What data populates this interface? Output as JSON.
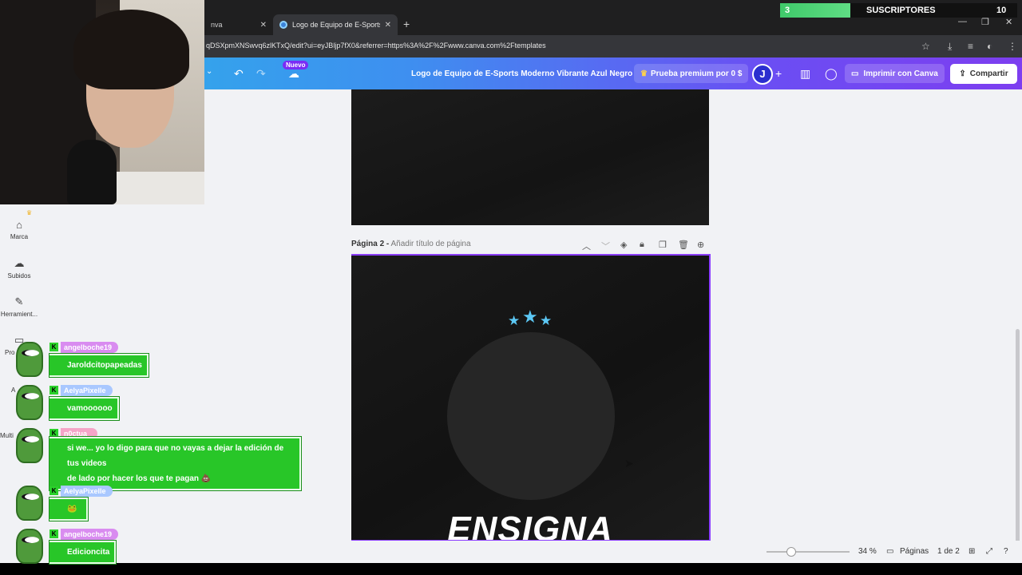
{
  "browser": {
    "tabs": [
      {
        "label": "nva",
        "active": false
      },
      {
        "label": "Logo de Equipo de E-Sports M",
        "active": true
      }
    ],
    "new_tab_icon": "+",
    "url": "qDSXpmXNSwvq6zlKTxQ/edit?ui=eyJBljp7fX0&referrer=https%3A%2F%2Fwww.canva.com%2Ftemplates"
  },
  "overlay_sub": {
    "current": "3",
    "label": "SUSCRIPTORES",
    "goal": "10",
    "progress": 0.3,
    "color": "#3fc96a"
  },
  "canva": {
    "nuevo_badge": "Nuevo",
    "document_title": "Logo de Equipo de E-Sports Moderno Vibrante Azul Negro",
    "premium_label": "Prueba premium por 0 $",
    "avatar_letter": "J",
    "print_label": "Imprimir con Canva",
    "share_label": "Compartir",
    "accent": "#8b3dff"
  },
  "page2": {
    "label": "Página 2 -",
    "title_placeholder": "Añadir título de página",
    "brand_text": "ENSIGNA",
    "star_color": "#5cc8f5"
  },
  "sidebar": {
    "items": [
      {
        "label": "Marca",
        "icon": "brand-icon"
      },
      {
        "label": "Subidos",
        "icon": "cloud-upload-icon"
      },
      {
        "label": "Herramient...",
        "icon": "pen-tool-icon"
      },
      {
        "label": "Pro",
        "icon": "folder-icon"
      },
      {
        "label": "A",
        "icon": "apps-icon"
      },
      {
        "label": "Multi",
        "icon": "multi-icon"
      }
    ]
  },
  "bottombar": {
    "zoom": "34 %",
    "zoom_value": 34,
    "pages_label": "Páginas",
    "page_count": "1 de 2"
  },
  "chat": [
    {
      "user": "angelboche19",
      "user_color": "#d98cf0",
      "message": "Jaroldcitopapeadas"
    },
    {
      "user": "AelyaPixelle",
      "user_color": "#a9c8ff",
      "message": "vamoooooo"
    },
    {
      "user": "n0ctua_",
      "user_color": "#f5a5c8",
      "message": "si we... yo lo digo para que no vayas a dejar la edición de tus videos",
      "message2": "de lado por hacer los que te pagan 💩"
    },
    {
      "user": "AelyaPixelle",
      "user_color": "#a9c8ff",
      "message": "🐸"
    },
    {
      "user": "angelboche19",
      "user_color": "#d98cf0",
      "message": "Edicioncita"
    }
  ]
}
